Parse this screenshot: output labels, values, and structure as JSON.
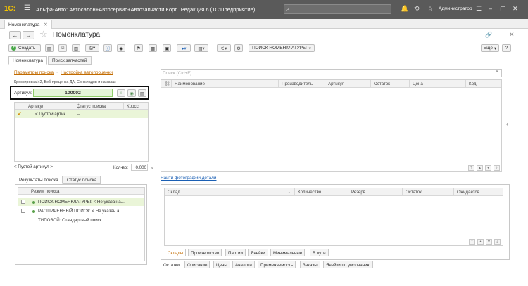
{
  "titlebar": {
    "logo": "1С:",
    "title": "Альфа-Авто: Автосалон+Автосервис+Автозапчасти Корп. Редакция 6  (1С:Предприятие)",
    "search_placeholder": "",
    "user": "Администратор"
  },
  "open_tab": {
    "label": "Номенклатура"
  },
  "header": {
    "title": "Номенклатура"
  },
  "toolbar": {
    "create": "Создать",
    "search_nom": "ПОИСК НОМЕНКЛАТУРЫ",
    "more": "Еще",
    "help": "?"
  },
  "page_tabs": [
    "Номенклатура",
    "Поиск запчастей"
  ],
  "left": {
    "links": {
      "params": "Параметры поиска",
      "setup": "Настройка автопроценки"
    },
    "cross_info": "Кроссировка >2, Веб-проценка ДА, Со складов и на заказ",
    "article_label": "Артикул:",
    "article_value": "100002",
    "grid": {
      "headers": [
        "Артикул",
        "Статус поиска",
        "Кросс."
      ],
      "rows": [
        {
          "article": "< Пустой артик...",
          "status": "--"
        }
      ]
    },
    "footer": {
      "empty_article": "< Пустой артикул >",
      "qty_label": "Кол-во:",
      "qty_value": "0,000"
    },
    "tabs": [
      "Результаты поиска",
      "Статус поиска"
    ],
    "modes_header": "Режим поиска",
    "modes": [
      "ПОИСК НОМЕНКЛАТУРЫ: < Не указан а...",
      "РАСШИРЕННЫЙ ПОИСК: < Не указан а...",
      "ТИПОВОЙ: Стандартный поиск"
    ]
  },
  "right": {
    "search_placeholder": "Поиск (Ctrl+F)",
    "clear": "×",
    "grid_headers": [
      "Наименование",
      "Производитель",
      "Артикул",
      "Остаток",
      "Цена",
      "Код"
    ],
    "find_photo": "Найти фотографии детали",
    "stock_headers": [
      "Склад",
      "Количество",
      "Резерв",
      "Остаток",
      "Ожидается"
    ],
    "sub_tabs": [
      "Склады",
      "Производство",
      "Партии",
      "Ячейки",
      "Минимальные",
      "В пути"
    ],
    "bottom_tabs": [
      "Остатки",
      "Описание",
      "Цены",
      "Аналоги",
      "Применяемость",
      "Заказы",
      "Ячейки по умолчанию"
    ]
  },
  "colors": {
    "titlebar": "#5a5a5a",
    "accent": "#f3c200",
    "highlight": "#eaf5d8",
    "link": "#c26b00"
  }
}
